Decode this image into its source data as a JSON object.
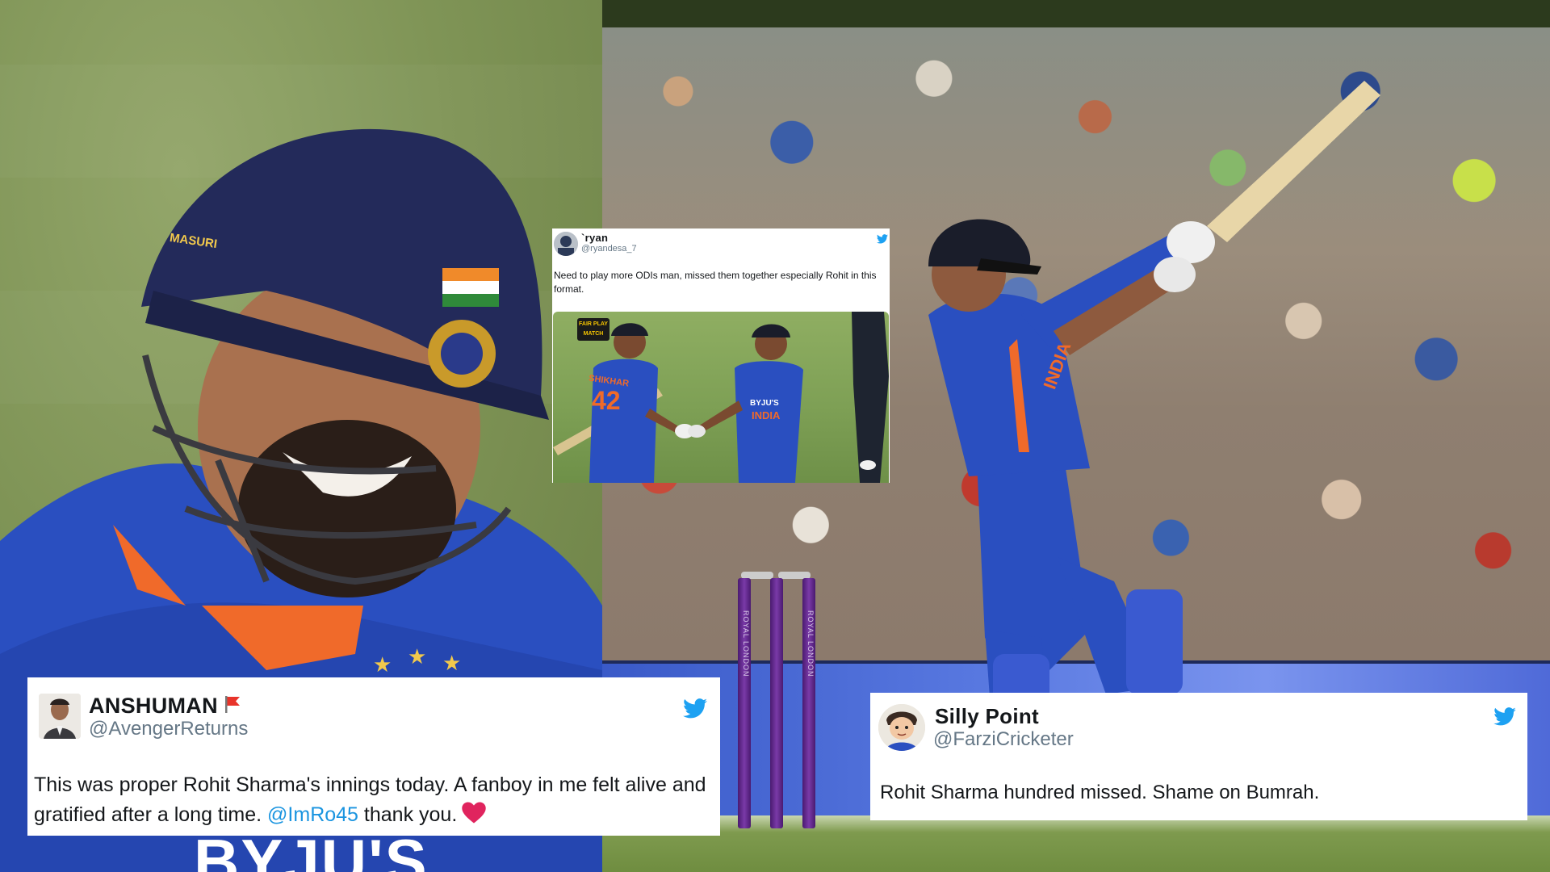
{
  "tweets": [
    {
      "display_name": "ANSHUMAN",
      "handle": "@AvengerReturns",
      "text_before": "This was proper Rohit Sharma's innings today. A fanboy in me felt alive and gratified after a long time. ",
      "mention": "@ImRo45",
      "text_after": " thank you.",
      "emoji": "heart-icon"
    },
    {
      "display_name": "Silly Point",
      "handle": "@FarziCricketer",
      "text": "Rohit Sharma hundred missed. Shame on Bumrah."
    },
    {
      "display_name": "`ryan",
      "handle": "@ryandesa_7",
      "text": "Need to play more ODIs man, missed them together especially Rohit in this format.",
      "media": {
        "jersey_left_number": "42",
        "jersey_left_name": "SHIKHAR",
        "jersey_right_brand": "BYJU'S",
        "jersey_right_team": "INDIA",
        "badge_text": "FAIR PLAY MATCH"
      }
    }
  ],
  "left_photo": {
    "helmet_brand": "MASURI",
    "shirt_sponsor": "BYJU'S"
  },
  "right_photo": {
    "stump_text_1": "ROYAL LONDON",
    "stump_text_2": "ROYAL LONDON",
    "shirt_text": "INDIA"
  },
  "colors": {
    "twitter_blue": "#1da1f2",
    "india_blue": "#2a4fc0",
    "stump_purple": "#5a2088",
    "heart_red": "#e0245e"
  }
}
